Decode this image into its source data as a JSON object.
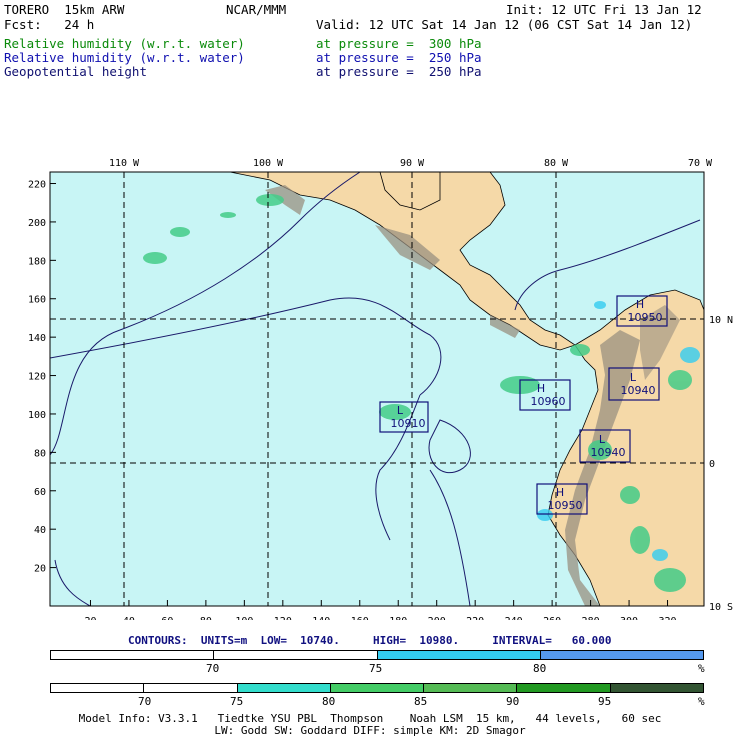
{
  "header": {
    "model": "TORERO  15km ARW",
    "org": "NCAR/MMM",
    "init": "Init: 12 UTC Fri 13 Jan 12",
    "fcst": "Fcst:   24 h",
    "valid": "Valid: 12 UTC Sat 14 Jan 12 (06 CST Sat 14 Jan 12)",
    "fields": [
      {
        "name": "Relative humidity (w.r.t. water)",
        "level": "at pressure =  300 hPa",
        "color": "#0a8a0a"
      },
      {
        "name": "Relative humidity (w.r.t. water)",
        "level": "at pressure =  250 hPa",
        "color": "#1010b0"
      },
      {
        "name": "Geopotential height",
        "level": "at pressure =  250 hPa",
        "color": "#101070"
      }
    ]
  },
  "map": {
    "lon_labels": [
      "110 W",
      "100 W",
      "90 W",
      "80 W",
      "70 W"
    ],
    "lat_labels": [
      "10 N",
      "0",
      "10 S"
    ],
    "y_ticks": [
      "220",
      "200",
      "180",
      "160",
      "140",
      "120",
      "100",
      "80",
      "60",
      "40",
      "20"
    ],
    "x_ticks": [
      "20",
      "40",
      "60",
      "80",
      "100",
      "120",
      "140",
      "160",
      "180",
      "200",
      "220",
      "240",
      "260",
      "280",
      "300",
      "320"
    ],
    "centers": [
      {
        "type": "H",
        "value": "10950"
      },
      {
        "type": "L",
        "value": "10940"
      },
      {
        "type": "H",
        "value": "10960"
      },
      {
        "type": "L",
        "value": "10910"
      },
      {
        "type": "L",
        "value": "10940"
      },
      {
        "type": "H",
        "value": "10950"
      }
    ],
    "colors": {
      "ocean": "#c8f5f5",
      "land": "#f5d9a8",
      "mountain": "#9a9080"
    }
  },
  "contours": {
    "text": "CONTOURS:  UNITS=m  LOW=  10740.     HIGH=  10980.     INTERVAL=   60.000"
  },
  "legend_250": {
    "labels": [
      "70",
      "75",
      "80",
      "%"
    ],
    "colors": [
      "#ffffff",
      "#ffffff",
      "#33ccf0",
      "#5599ee"
    ]
  },
  "legend_300": {
    "labels": [
      "70",
      "75",
      "80",
      "85",
      "90",
      "95",
      "%"
    ],
    "colors": [
      "#ffffff",
      "#ffffff",
      "#33ddcc",
      "#44cc66",
      "#55bb55",
      "#229922",
      "#335533"
    ]
  },
  "footer": {
    "line1": "Model Info: V3.3.1   Tiedtke YSU PBL  Thompson    Noah LSM  15 km,   44 levels,   60 sec",
    "line2": "LW: Godd SW: Goddard DIFF: simple KM: 2D Smagor"
  }
}
